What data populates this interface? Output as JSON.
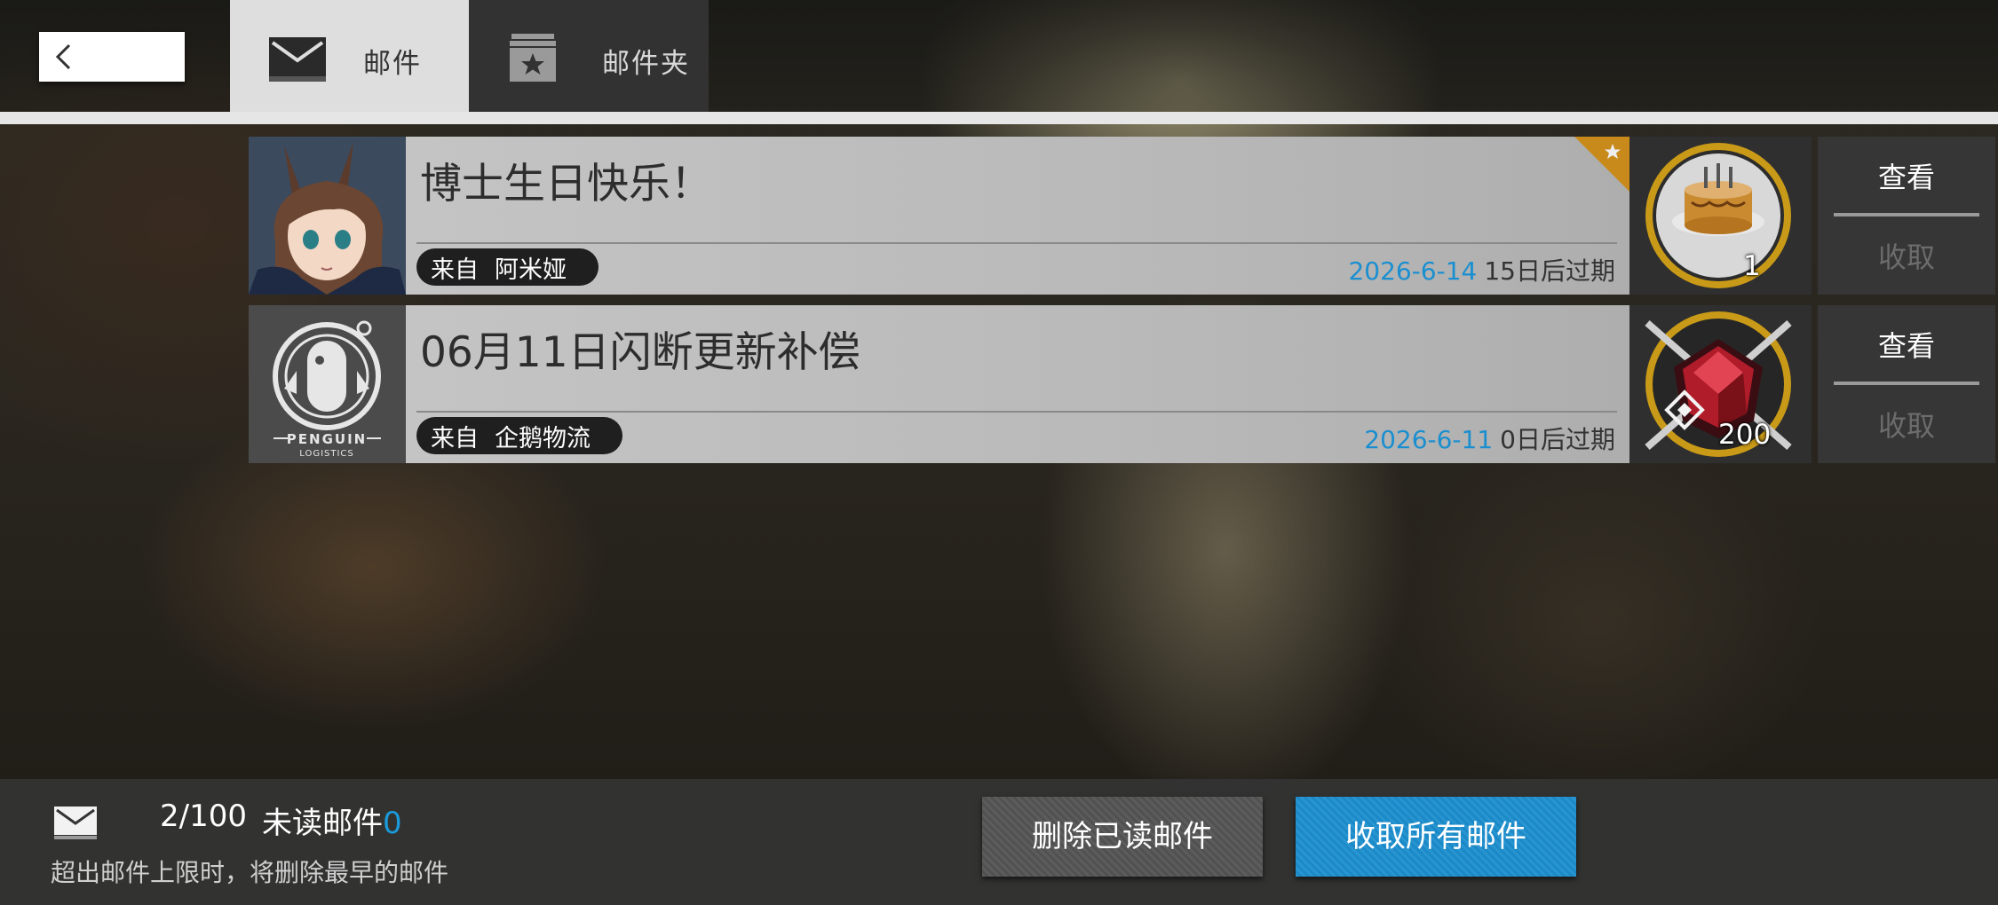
{
  "tabs": [
    {
      "label": "邮件",
      "icon": "envelope-icon",
      "active": true
    },
    {
      "label": "邮件夹",
      "icon": "starred-box-icon",
      "active": false
    }
  ],
  "mails": [
    {
      "title": "博士生日快乐！",
      "from_prefix": "来自",
      "sender": "阿米娅",
      "date": "2026-6-14",
      "expiry": "15日后过期",
      "starred": true,
      "avatar": "amiya-portrait",
      "reward_icon": "birthday-cake-icon",
      "reward_count": "1",
      "view_label": "查看",
      "collect_label": "收取"
    },
    {
      "title": "06月11日闪断更新补偿",
      "from_prefix": "来自",
      "sender": "企鹅物流",
      "date": "2026-6-11",
      "expiry": "0日后过期",
      "starred": false,
      "avatar": "penguin-logistics-logo",
      "avatar_text": "PENGUIN",
      "avatar_subtext": "LOGISTICS",
      "reward_icon": "originium-crystal-icon",
      "reward_count": "200",
      "view_label": "查看",
      "collect_label": "收取"
    }
  ],
  "footer": {
    "count": "2/100",
    "unread_label": "未读邮件",
    "unread_count": "0",
    "limit_note": "超出邮件上限时，将删除最早的邮件",
    "delete_read_label": "删除已读邮件",
    "collect_all_label": "收取所有邮件"
  },
  "colors": {
    "accent_blue": "#1c8fcf",
    "date_blue": "#1a8fd0",
    "star_gold": "#c98a1c"
  }
}
